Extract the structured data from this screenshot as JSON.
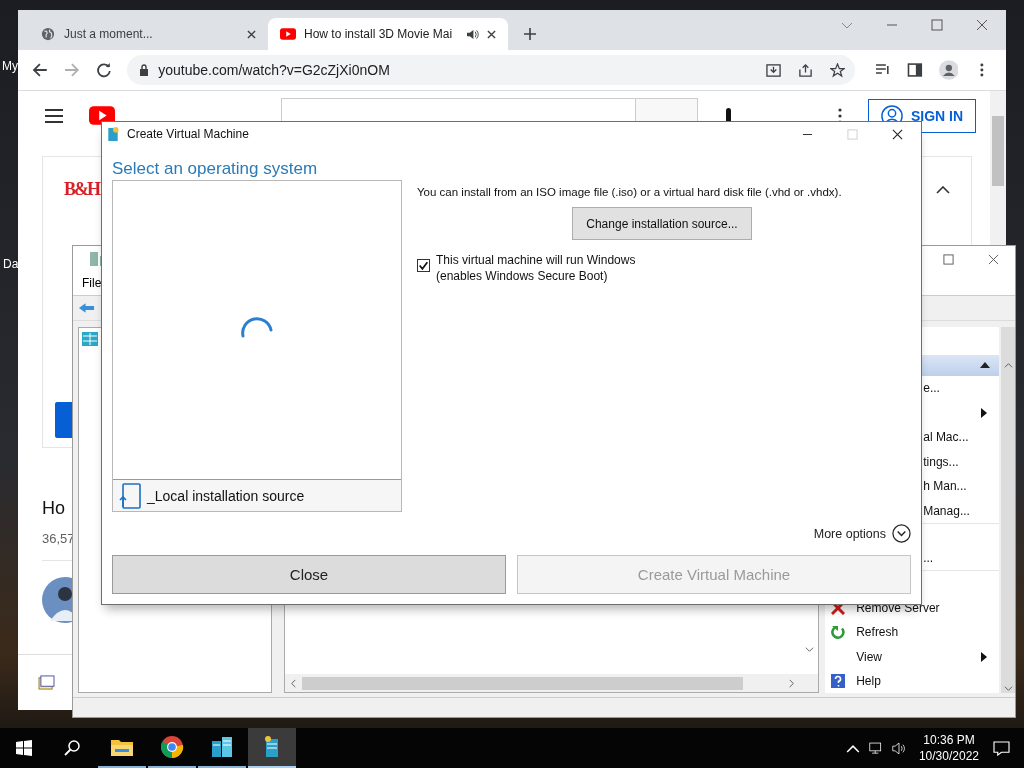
{
  "desktop": {
    "icon_labels": [
      "My",
      "Da"
    ]
  },
  "browser": {
    "tabs": [
      {
        "kind": "globe",
        "title": "Just a moment...",
        "selected": false,
        "audio": false
      },
      {
        "kind": "youtube",
        "title": "How to install 3D Movie Mai",
        "selected": true,
        "audio": true
      }
    ],
    "address": "youtube.com/watch?v=G2cZjXi0nOM",
    "youtube": {
      "sign_in": "SIGN IN",
      "ad_logo": "B&H",
      "video_title": "Ho",
      "views": "36,57"
    }
  },
  "hyperv": {
    "menu": [
      "File"
    ],
    "actions": [
      {
        "label": "e...",
        "submenu": false
      },
      {
        "submenu": true
      },
      {
        "label": "al Mac...",
        "submenu": false
      },
      {
        "label": "tings...",
        "submenu": false
      },
      {
        "label": "h Man...",
        "submenu": false
      },
      {
        "label": "Manag...",
        "submenu": false
      }
    ],
    "actions_middle": [
      {
        "label": "...",
        "submenu": false
      }
    ],
    "actions_lower": [
      {
        "label": "Remove Server",
        "submenu": false,
        "kind": "remove"
      },
      {
        "label": "Refresh",
        "submenu": false,
        "kind": "refresh"
      },
      {
        "label": "View",
        "submenu": true
      },
      {
        "label": "Help",
        "submenu": false,
        "kind": "help"
      }
    ]
  },
  "dialog": {
    "title": "Create Virtual Machine",
    "heading": "Select an operating system",
    "loading": true,
    "source_item": "_Local installation source",
    "info": "You can install from an ISO image file (.iso) or a virtual hard disk file (.vhd or .vhdx).",
    "change_button": "Change installation source...",
    "windows_checkbox": {
      "checked": true,
      "label": [
        "This virtual machine will run Windows",
        "(enables Windows Secure Boot)"
      ]
    },
    "more_options": "More options",
    "buttons": [
      {
        "label": "Close",
        "disabled": false
      },
      {
        "label": "Create Virtual Machine",
        "disabled": true
      }
    ]
  },
  "taskbar": {
    "apps": [
      {
        "kind": "explorer",
        "selected": false
      },
      {
        "kind": "chrome",
        "selected": false
      },
      {
        "kind": "hyperv",
        "selected": false
      },
      {
        "kind": "vmconnect",
        "selected": true
      }
    ],
    "time": "10:36 PM",
    "date": "10/30/2022"
  }
}
